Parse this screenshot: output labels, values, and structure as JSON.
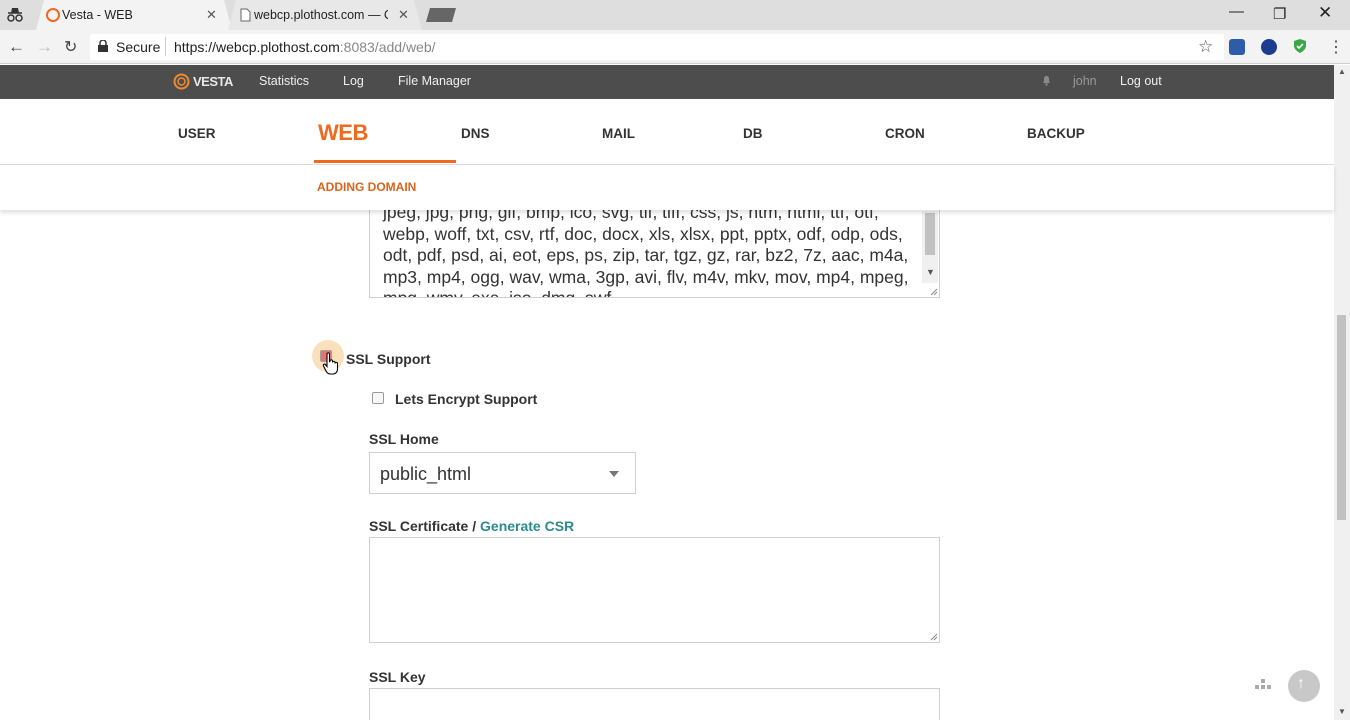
{
  "browser": {
    "tabs": [
      {
        "title": "Vesta - WEB",
        "active": true
      },
      {
        "title": "webcp.plothost.com — C",
        "active": false
      }
    ],
    "secure_label": "Secure",
    "url_main": "https://webcp.plothost.com",
    "url_rest": ":8083/add/web/"
  },
  "topbar": {
    "logo": "VESTA",
    "links": [
      "Statistics",
      "Log",
      "File Manager"
    ],
    "user": "john",
    "logout": "Log out"
  },
  "nav": {
    "items": [
      "USER",
      "WEB",
      "DNS",
      "MAIL",
      "DB",
      "CRON",
      "BACKUP"
    ],
    "active": "WEB"
  },
  "subnav": {
    "title": "ADDING DOMAIN"
  },
  "form": {
    "extensions_text": "jpeg, jpg, png, gif, bmp, ico, svg, tif, tiff, css, js, htm, html, ttf, otf, webp, woff, txt, csv, rtf, doc, docx, xls, xlsx, ppt, pptx, odf, odp, ods, odt, pdf, psd, ai, eot, eps, ps, zip, tar, tgz, gz, rar, bz2, 7z, aac, m4a, mp3, mp4, ogg, wav, wma, 3gp, avi, flv, m4v, mkv, mov, mp4, mpeg, mpg, wmv, exe, iso, dmg, swf",
    "ssl_support_label": "SSL Support",
    "letsencrypt_label": "Lets Encrypt Support",
    "ssl_home_label": "SSL Home",
    "ssl_home_value": "public_html",
    "ssl_cert_label": "SSL Certificate /",
    "generate_csr": "Generate CSR",
    "ssl_key_label": "SSL Key"
  },
  "colors": {
    "accent": "#ef6a1e",
    "topbar": "#4d4d4d",
    "link": "#2e8b8b"
  }
}
